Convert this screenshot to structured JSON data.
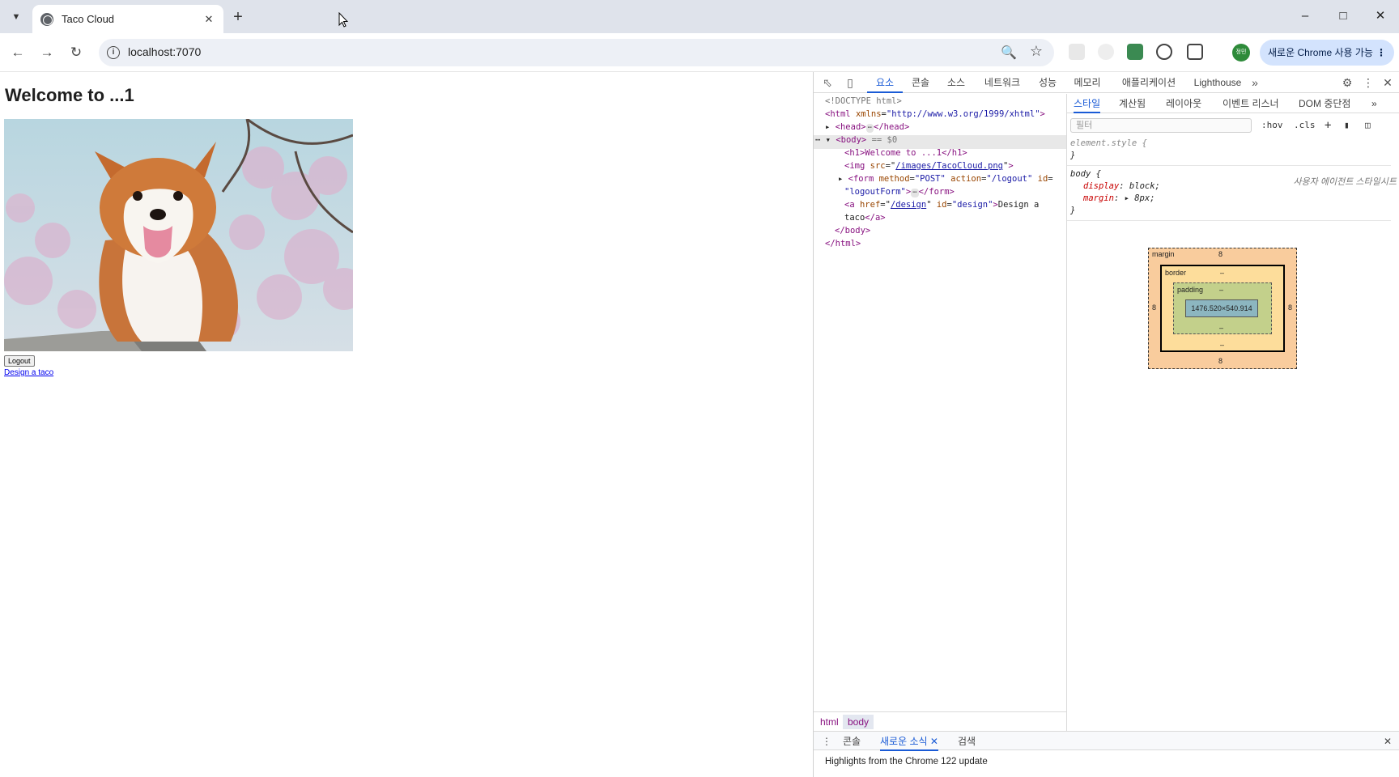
{
  "browser": {
    "tab_title": "Taco Cloud",
    "url": "localhost:7070",
    "update_chip_label": "새로운 Chrome 사용 가능",
    "profile_initials": "정민",
    "icons": {
      "tab_menu": "chevron-down-icon",
      "favicon": "globe-icon",
      "new_tab": "plus-icon",
      "back": "arrow-left-icon",
      "forward": "arrow-right-icon",
      "reload": "reload-icon",
      "site_info": "info-icon",
      "zoom": "zoom-icon",
      "bookmark": "star-icon"
    }
  },
  "page": {
    "heading": "Welcome to ...1",
    "logout_button": "Logout",
    "design_link": "Design a taco"
  },
  "devtools": {
    "tabs": [
      "요소",
      "콘솔",
      "소스",
      "네트워크",
      "성능",
      "메모리",
      "애플리케이션",
      "Lighthouse"
    ],
    "active_tab": "요소",
    "dom_tree": {
      "doctype": "<!DOCTYPE html>",
      "html_open_tag": "<html",
      "html_attr": "xmlns",
      "html_attr_value": "\"http://www.w3.org/1999/xhtml\"",
      "head_open": "<head>",
      "head_close": "</head>",
      "body_open": "<body>",
      "body_marker": "== $0",
      "h1_line": "<h1>Welcome to ...1</h1>",
      "img_tag": "<img",
      "img_attr": "src",
      "img_src": "/images/TacoCloud.png",
      "form_tag": "<form",
      "form_method_attr": "method",
      "form_method_value": "\"POST\"",
      "form_action_attr": "action",
      "form_action_value": "\"/logout\"",
      "form_id_attr": "id",
      "form_id_value": "\"logoutForm\"",
      "form_close": "</form>",
      "a_tag": "<a",
      "a_href_attr": "href",
      "a_href": "/design",
      "a_id_attr": "id",
      "a_id_value": "\"design\"",
      "a_text_1": "Design a",
      "a_text_2": "taco",
      "a_close": "</a>",
      "body_close": "</body>",
      "html_close": "</html>",
      "ellipsis": "⋯"
    },
    "breadcrumbs": [
      "html",
      "body"
    ],
    "styles_tabs": [
      "스타일",
      "계산됨",
      "레이아웃",
      "이벤트 리스너",
      "DOM 중단점"
    ],
    "filter_placeholder": "필터",
    "filter_tools": [
      ":hov",
      ".cls"
    ],
    "element_style_selector": "element.style {",
    "close_brace": "}",
    "body_rule": {
      "selector": "body {",
      "source_label": "사용자 에이전트 스타일시트",
      "display_prop": "display",
      "display_value": "block;",
      "margin_prop": "margin",
      "margin_value": "8px;"
    },
    "box_model": {
      "margin_label": "margin",
      "margin_value": "8",
      "border_label": "border",
      "border_value": "–",
      "padding_label": "padding",
      "padding_value": "–",
      "content_size": "1476.520×540.914"
    },
    "drawer_tabs": [
      "콘솔",
      "새로운 소식",
      "검색"
    ],
    "drawer_active": "새로운 소식",
    "drawer_message": "Highlights from the Chrome 122 update"
  }
}
